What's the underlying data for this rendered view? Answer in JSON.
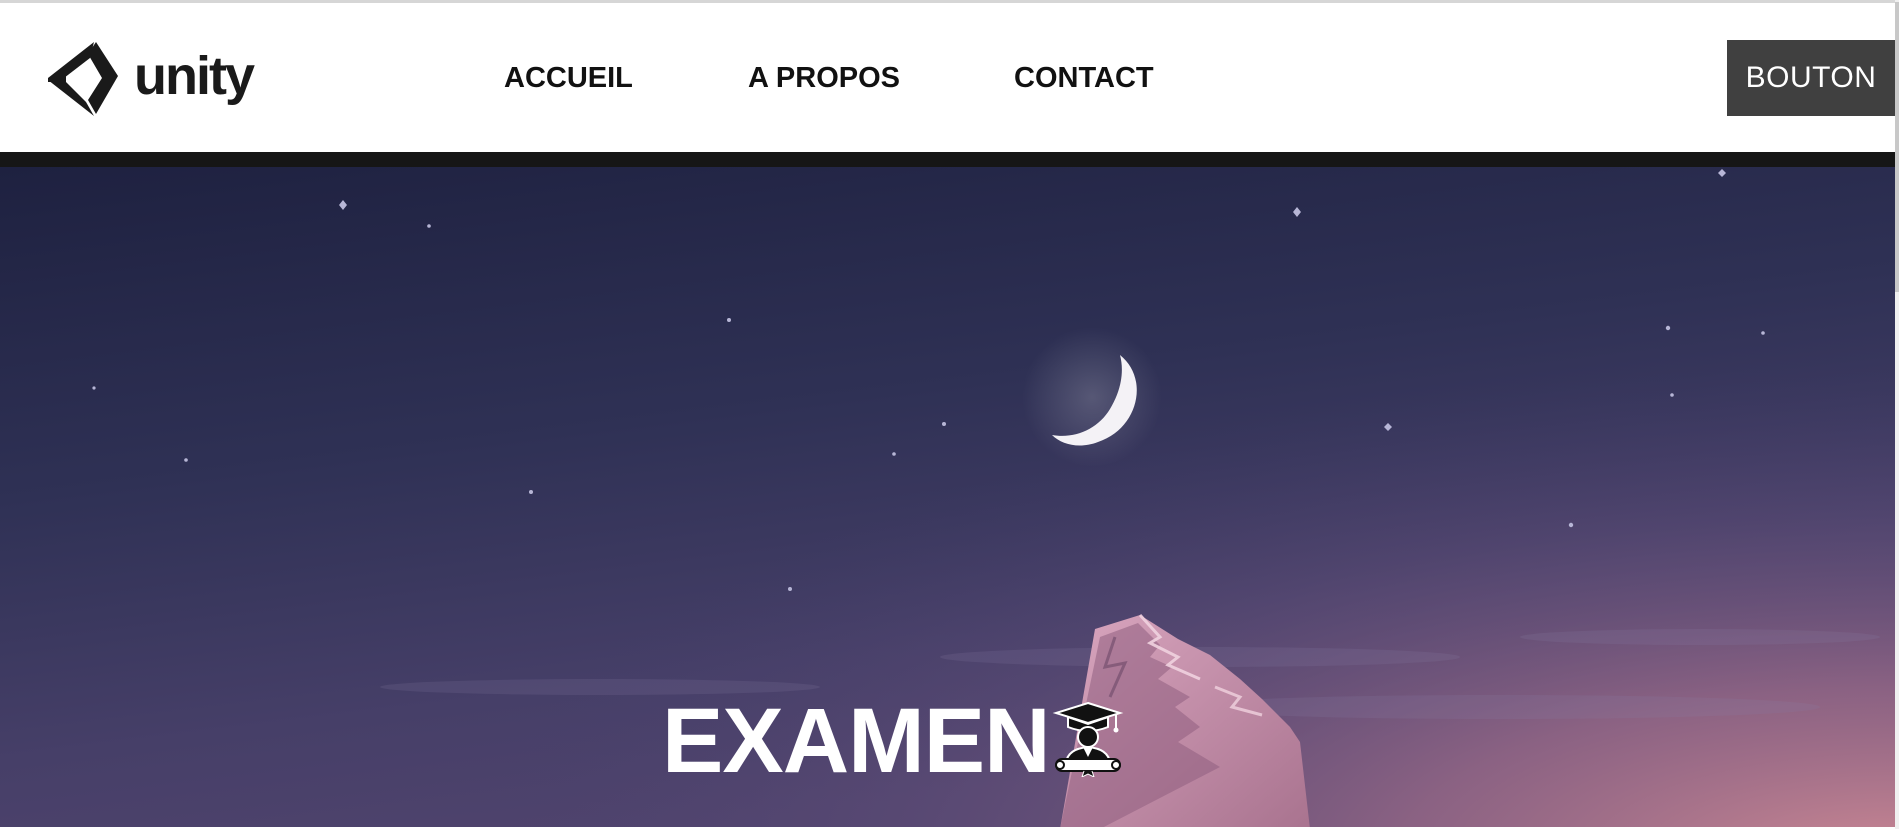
{
  "header": {
    "logo": {
      "text": "unity",
      "icon": "unity-cube-icon"
    },
    "nav": [
      {
        "label": "ACCUEIL"
      },
      {
        "label": "A PROPOS"
      },
      {
        "label": "CONTACT"
      }
    ],
    "button_label": "BOUTON"
  },
  "hero": {
    "title": "EXAMEN",
    "title_icon": "graduate-icon",
    "background": "night-sky-mountain-illustration",
    "moon_icon": "crescent-moon-icon"
  },
  "colors": {
    "header_bg": "#ffffff",
    "nav_text": "#111111",
    "button_bg": "#404040",
    "button_text": "#ffffff",
    "band": "#161616",
    "sky_top": "#1f2240",
    "sky_mid": "#3b3a63",
    "sky_horizon": "#c08292"
  }
}
